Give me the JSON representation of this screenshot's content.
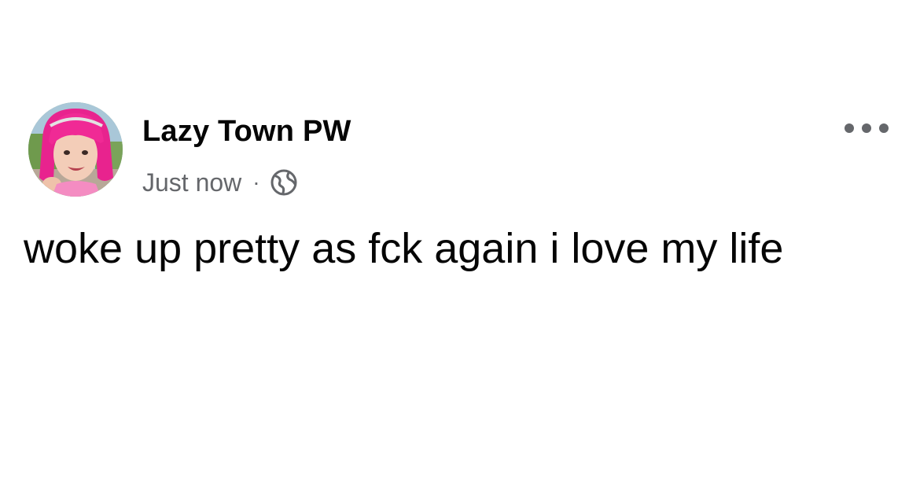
{
  "post": {
    "author": "Lazy Town PW",
    "timestamp": "Just now",
    "separator": "·",
    "audience_icon": "globe-icon",
    "more_icon": "more-options-icon",
    "text": "woke up pretty as fck again i love my life",
    "avatar_icon": "profile-photo"
  },
  "colors": {
    "text_primary": "#050505",
    "text_secondary": "#65676b",
    "background": "#ffffff",
    "avatar_hair": "#e8238e"
  }
}
